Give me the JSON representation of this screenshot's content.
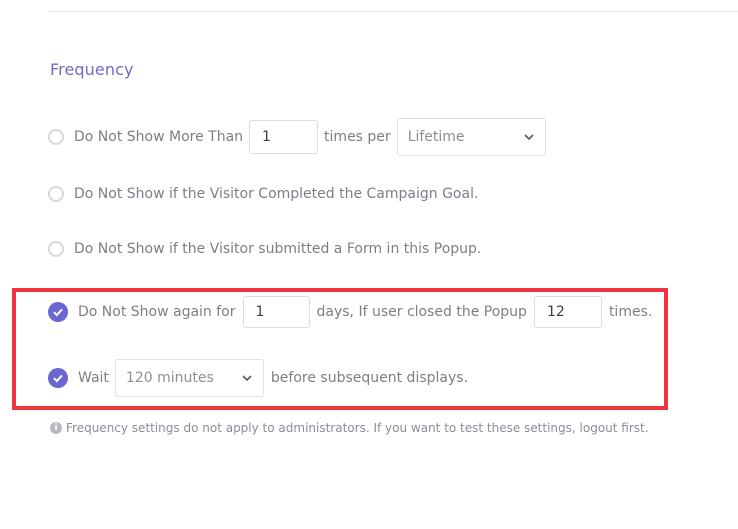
{
  "section": {
    "title": "Frequency"
  },
  "options": {
    "max_show": {
      "label_before": "Do Not Show More Than",
      "count_value": "1",
      "label_mid": "times per",
      "period_selected": "Lifetime",
      "checked": false
    },
    "campaign_goal": {
      "label": "Do Not Show if the Visitor Completed the Campaign Goal.",
      "checked": false
    },
    "form_submitted": {
      "label": "Do Not Show if the Visitor submitted a Form in this Popup.",
      "checked": false
    },
    "closed_popup": {
      "label_before": "Do Not Show again for",
      "days_value": "1",
      "label_mid": "days, If user closed the Popup",
      "times_value": "12",
      "label_after": "times.",
      "checked": true
    },
    "wait": {
      "label_before": "Wait",
      "delay_selected": "120 minutes",
      "label_after": "before subsequent displays.",
      "checked": true
    }
  },
  "note": {
    "icon": "info-icon",
    "text": "Frequency settings do not apply to administrators. If you want to test these settings, logout first."
  },
  "colors": {
    "accent": "#6a67cf",
    "title": "#6f6cc5",
    "highlight": "#f0343f"
  }
}
